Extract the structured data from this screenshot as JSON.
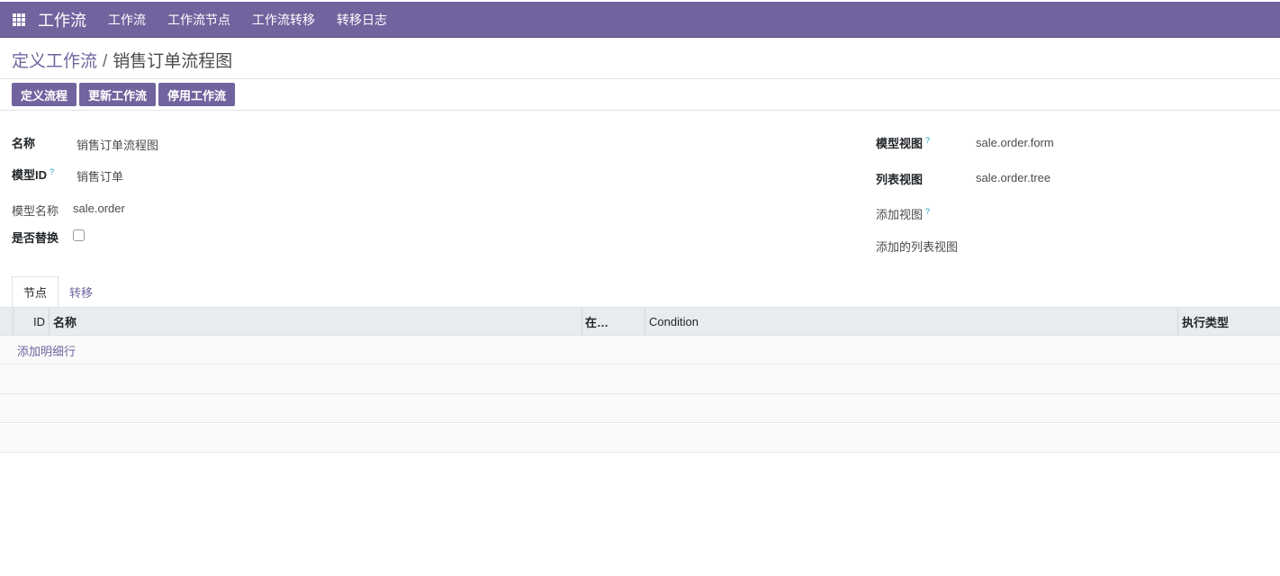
{
  "navbar": {
    "app_title": "工作流",
    "menu": [
      "工作流",
      "工作流节点",
      "工作流转移",
      "转移日志"
    ]
  },
  "breadcrumb": {
    "parent": "定义工作流",
    "separator": "/",
    "current": "销售订单流程图"
  },
  "actions": {
    "define_flow": "定义流程",
    "update_workflow": "更新工作流",
    "disable_workflow": "停用工作流"
  },
  "form": {
    "name_label": "名称",
    "name_value": "销售订单流程图",
    "model_id_label": "模型ID",
    "model_id_value": "销售订单",
    "model_name_label": "模型名称",
    "model_name_value": "sale.order",
    "replace_label": "是否替换",
    "replace_checked": false,
    "model_view_label": "模型视图",
    "model_view_value": "sale.order.form",
    "list_view_label": "列表视图",
    "list_view_value": "sale.order.tree",
    "add_view_label": "添加视图",
    "add_list_view_label": "添加的列表视图",
    "help_mark": "?"
  },
  "tabs": {
    "nodes": "节点",
    "transitions": "转移"
  },
  "table": {
    "columns": [
      "ID",
      "名称",
      "在…",
      "Condition",
      "执行类型"
    ],
    "add_line": "添加明细行"
  },
  "colors": {
    "brand": "#71639e",
    "help": "#17a2b8"
  }
}
